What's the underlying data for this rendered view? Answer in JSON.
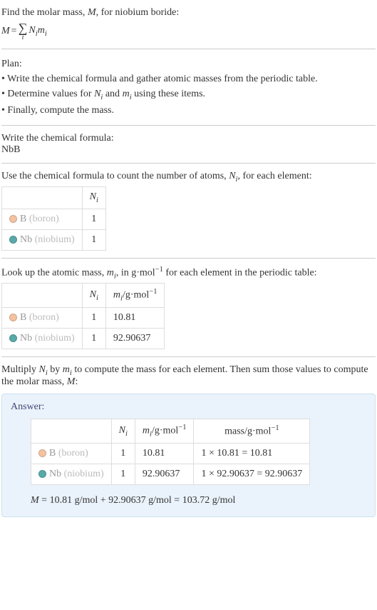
{
  "intro": {
    "prompt_prefix": "Find the molar mass, ",
    "prompt_var": "M",
    "prompt_suffix": ", for niobium boride:",
    "eq_lhs": "M",
    "eq_equals": " = ",
    "sigma_sub": "i",
    "rhs_Ni": "N",
    "rhs_Ni_sub": "i",
    "rhs_mi": "m",
    "rhs_mi_sub": "i"
  },
  "plan": {
    "heading": "Plan:",
    "line1": "• Write the chemical formula and gather atomic masses from the periodic table.",
    "line2_a": "• Determine values for ",
    "line2_Ni": "N",
    "line2_Ni_sub": "i",
    "line2_mid": " and ",
    "line2_mi": "m",
    "line2_mi_sub": "i",
    "line2_b": " using these items.",
    "line3": "• Finally, compute the mass."
  },
  "formula_section": {
    "heading": "Write the chemical formula:",
    "formula": "NbB"
  },
  "count_section": {
    "text_a": "Use the chemical formula to count the number of atoms, ",
    "Ni": "N",
    "Ni_sub": "i",
    "text_b": ", for each element:",
    "col_Ni": "N",
    "col_Ni_sub": "i",
    "rows": [
      {
        "sym": "B",
        "name": "(boron)",
        "swatch": "pink",
        "n": "1"
      },
      {
        "sym": "Nb",
        "name": "(niobium)",
        "swatch": "teal",
        "n": "1"
      }
    ]
  },
  "mass_section": {
    "text_a": "Look up the atomic mass, ",
    "mi": "m",
    "mi_sub": "i",
    "text_b": ", in g·mol",
    "text_exp": "−1",
    "text_c": " for each element in the periodic table:",
    "col_Ni": "N",
    "col_Ni_sub": "i",
    "col_mi": "m",
    "col_mi_sub": "i",
    "col_unit": "/g·mol",
    "col_exp": "−1",
    "rows": [
      {
        "sym": "B",
        "name": "(boron)",
        "swatch": "pink",
        "n": "1",
        "m": "10.81"
      },
      {
        "sym": "Nb",
        "name": "(niobium)",
        "swatch": "teal",
        "n": "1",
        "m": "92.90637"
      }
    ]
  },
  "multiply_section": {
    "text_a": "Multiply ",
    "Ni": "N",
    "Ni_sub": "i",
    "text_b": " by ",
    "mi": "m",
    "mi_sub": "i",
    "text_c": " to compute the mass for each element. Then sum those values to compute the molar mass, ",
    "M": "M",
    "text_d": ":"
  },
  "answer": {
    "label": "Answer:",
    "col_Ni": "N",
    "col_Ni_sub": "i",
    "col_mi": "m",
    "col_mi_sub": "i",
    "col_unit": "/g·mol",
    "col_exp": "−1",
    "col_mass": "mass/g·mol",
    "col_mass_exp": "−1",
    "rows": [
      {
        "sym": "B",
        "name": "(boron)",
        "swatch": "pink",
        "n": "1",
        "m": "10.81",
        "calc": "1 × 10.81 = 10.81"
      },
      {
        "sym": "Nb",
        "name": "(niobium)",
        "swatch": "teal",
        "n": "1",
        "m": "92.90637",
        "calc": "1 × 92.90637 = 92.90637"
      }
    ],
    "final_lhs": "M",
    "final_eq": " = 10.81 g/mol + 92.90637 g/mol = 103.72 g/mol"
  }
}
